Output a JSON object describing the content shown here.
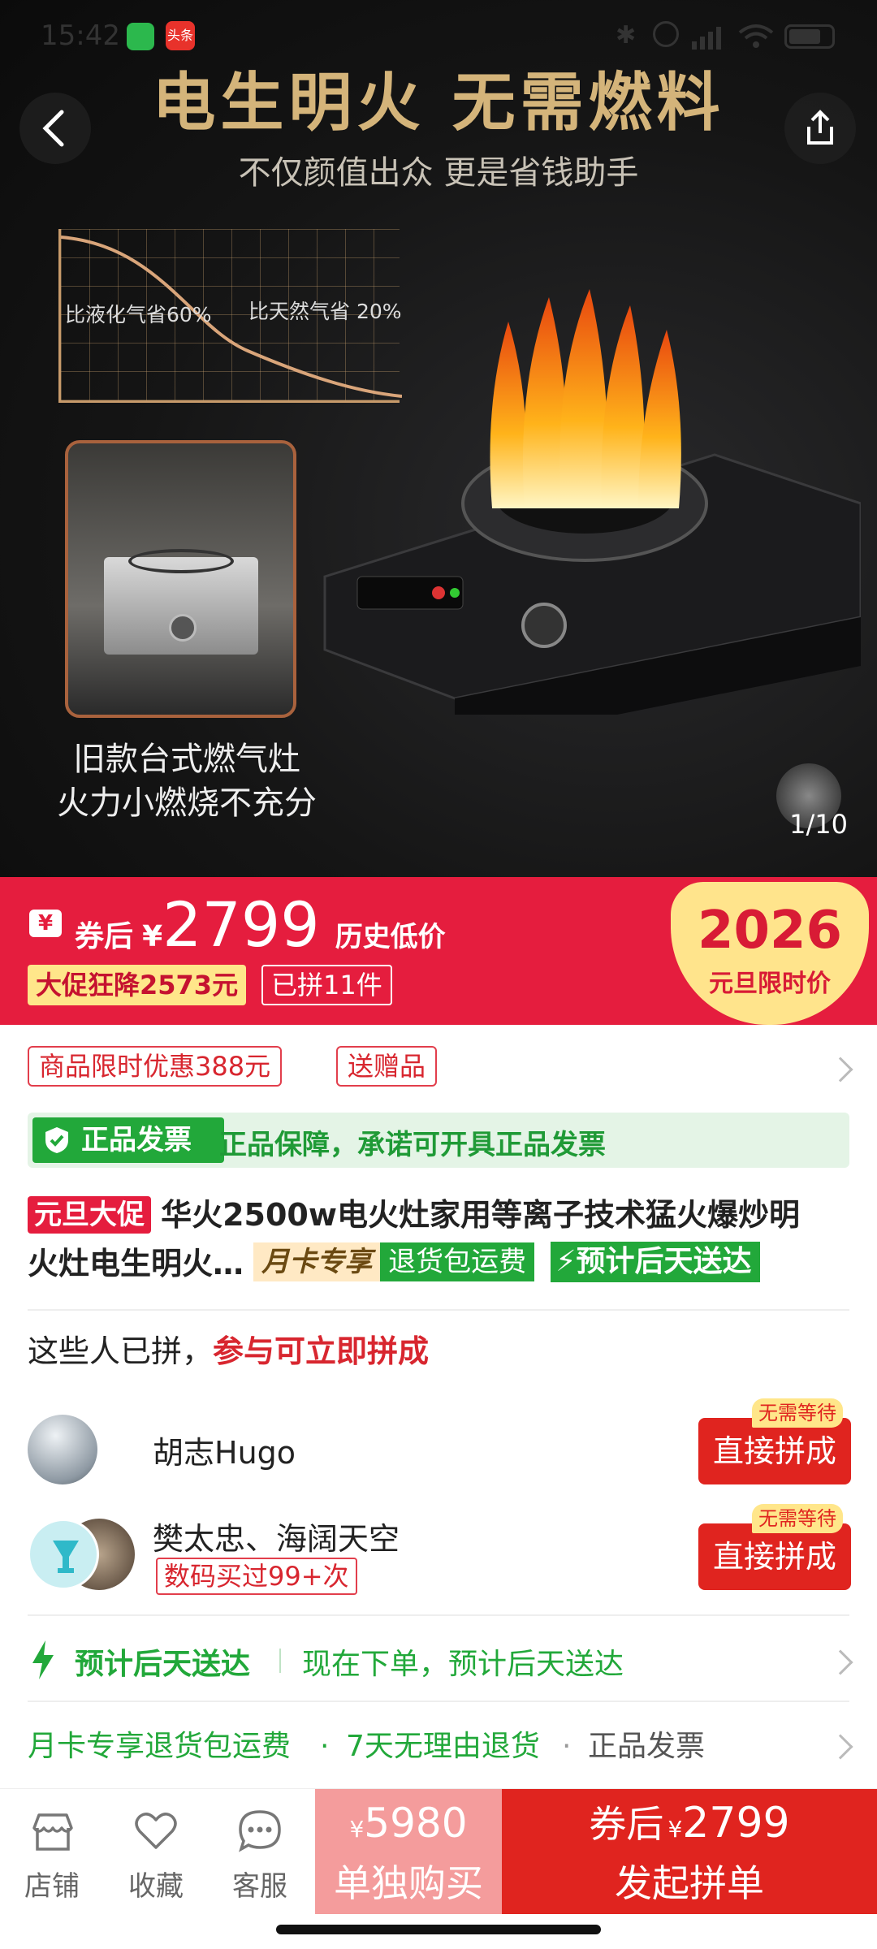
{
  "status": {
    "time": "15:42",
    "app_badge": "头条"
  },
  "hero": {
    "title": "电生明火 无需燃料",
    "subtitle": "不仅颜值出众 更是省钱助手",
    "chart_label_lpg": "比液化气省60%",
    "chart_label_gas": "比天然气省 20%",
    "old_caption_1": "旧款台式燃气灶",
    "old_caption_2": "火力小燃烧不充分",
    "page_indicator": "1/10"
  },
  "price": {
    "prefix": "券后",
    "currency": "¥",
    "amount": "2799",
    "suffix": "历史低价",
    "promo_tag": "大促狂降2573元",
    "group_count": "已拼11件",
    "event_year": "2026",
    "event_label": "元旦限时价"
  },
  "offers": {
    "discount": "商品限时优惠388元",
    "gift": "送赠品"
  },
  "authentic": {
    "badge": "正品发票",
    "text": "正品保障，承诺可开具正品发票"
  },
  "product": {
    "promo_badge": "元旦大促",
    "title_line1": "华火2500w电火灶家用等离子技术猛火爆炒明",
    "title_line2": "火灶电生明火…",
    "tag_member": "月卡专享",
    "tag_return": "退货包运费",
    "tag_delivery": "预计后天送达"
  },
  "group": {
    "heading": "这些人已拼，",
    "heading_highlight": "参与可立即拼成",
    "rows": [
      {
        "name": "胡志Hugo",
        "badge": "无需等待",
        "button": "直接拼成"
      },
      {
        "name": "樊太忠、海阔天空",
        "sub": "数码买过99+次",
        "badge": "无需等待",
        "button": "直接拼成"
      }
    ]
  },
  "delivery": {
    "label": "预计后天送达",
    "detail": "现在下单，预计后天送达"
  },
  "services": {
    "item1": "月卡专享退货包运费",
    "item2": "7天无理由退货",
    "item3": "正品发票"
  },
  "bottom": {
    "store": "店铺",
    "favorite": "收藏",
    "service": "客服",
    "single_price_currency": "¥",
    "single_price": "5980",
    "single_label": "单独购买",
    "group_price_prefix": "券后",
    "group_price_currency": "¥",
    "group_price": "2799",
    "group_label": "发起拼单"
  },
  "colors": {
    "brand_red": "#e51d3e",
    "green": "#22a83a",
    "gold": "#d4b47a"
  }
}
